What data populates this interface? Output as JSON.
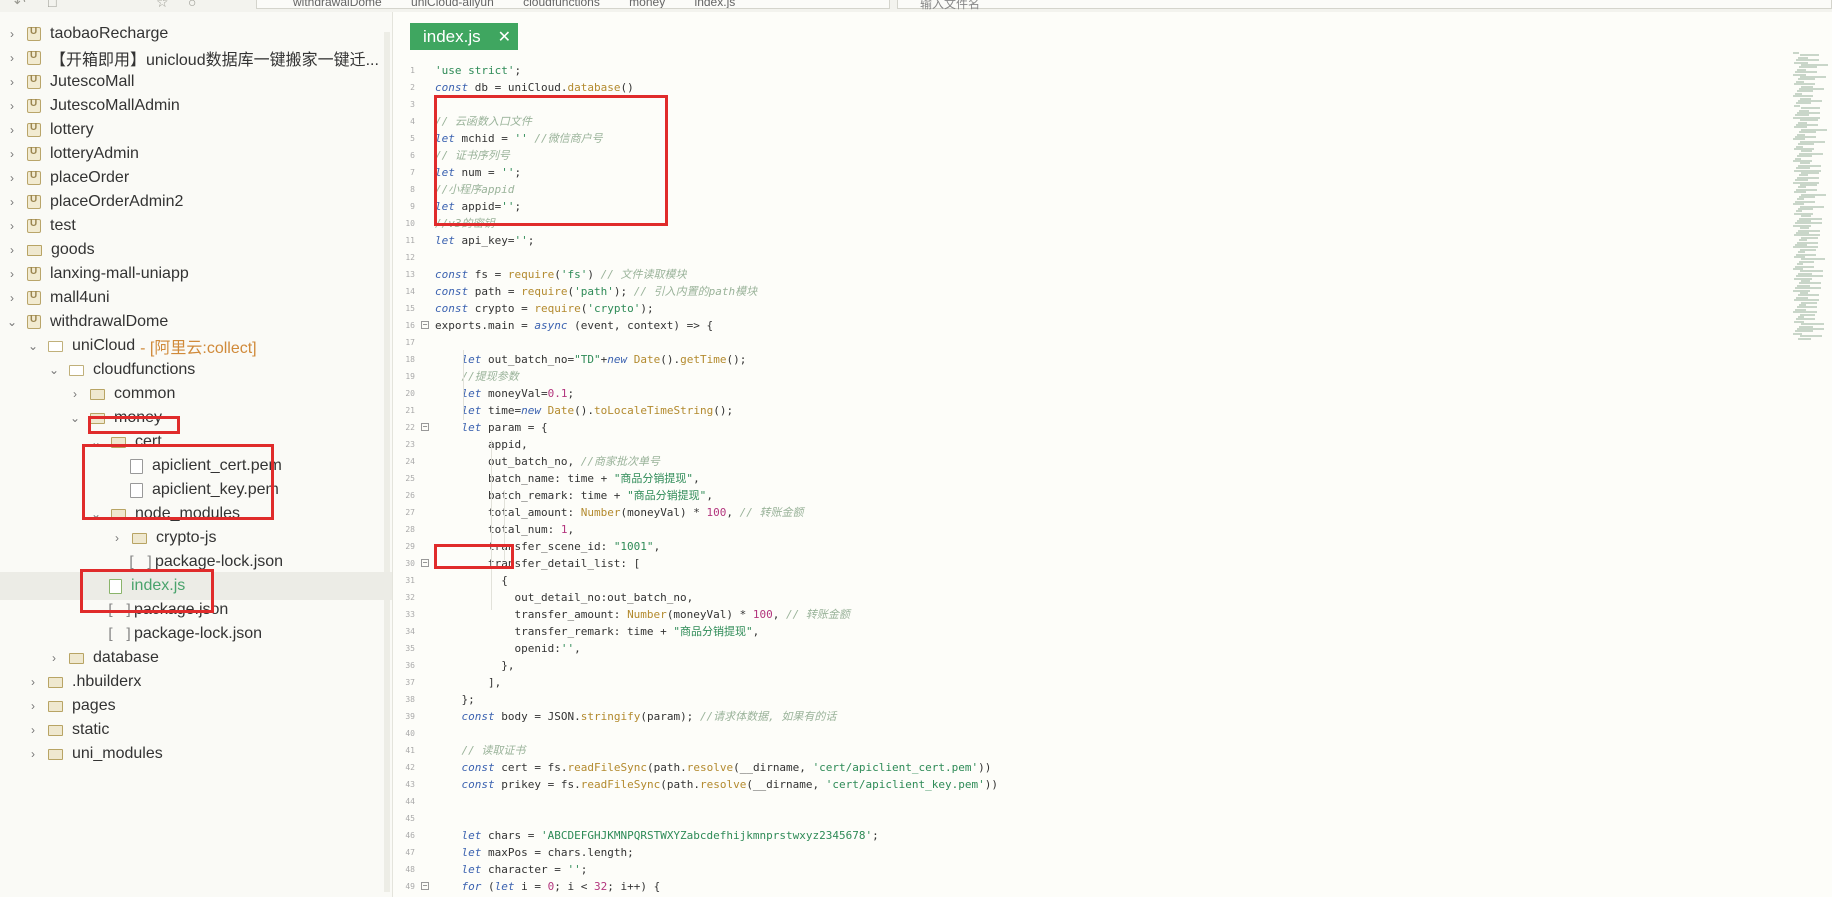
{
  "toolbar": {
    "breadcrumb": [
      "withdrawalDome",
      "uniCloud-aliyun",
      "cloudfunctions",
      "money",
      "index.js"
    ],
    "search_placeholder": "输入文件名"
  },
  "sidebar": {
    "items": [
      {
        "label": "taobaoRecharge"
      },
      {
        "label": "【开箱即用】unicloud数据库一键搬家一键迁..."
      },
      {
        "label": "JutescoMall"
      },
      {
        "label": "JutescoMallAdmin"
      },
      {
        "label": "lottery"
      },
      {
        "label": "lotteryAdmin"
      },
      {
        "label": "placeOrder"
      },
      {
        "label": "placeOrderAdmin2"
      },
      {
        "label": "test"
      },
      {
        "label": "goods"
      },
      {
        "label": "lanxing-mall-uniapp"
      },
      {
        "label": "mall4uni"
      },
      {
        "label": "withdrawalDome"
      },
      {
        "label": "uniCloud",
        "tag": "- [阿里云:collect]"
      },
      {
        "label": "cloudfunctions"
      },
      {
        "label": "common"
      },
      {
        "label": "money"
      },
      {
        "label": "cert"
      },
      {
        "label": "apiclient_cert.pem"
      },
      {
        "label": "apiclient_key.pem"
      },
      {
        "label": "node_modules"
      },
      {
        "label": "crypto-js"
      },
      {
        "label": "package-lock.json"
      },
      {
        "label": "index.js"
      },
      {
        "label": "package.json"
      },
      {
        "label": "package-lock.json"
      },
      {
        "label": "database"
      },
      {
        "label": ".hbuilderx"
      },
      {
        "label": "pages"
      },
      {
        "label": "static"
      },
      {
        "label": "uni_modules"
      }
    ]
  },
  "editor": {
    "tab_label": "index.js",
    "line_numbers": [
      "1",
      "2",
      "3",
      "4",
      "5",
      "6",
      "7",
      "8",
      "9",
      "10",
      "11",
      "12",
      "13",
      "14",
      "15",
      "16",
      "17",
      "18",
      "19",
      "20",
      "21",
      "22",
      "23",
      "24",
      "25",
      "26",
      "27",
      "28",
      "29",
      "30",
      "31",
      "32",
      "33",
      "34",
      "35",
      "36",
      "37",
      "38",
      "39",
      "40",
      "41",
      "42",
      "43",
      "44",
      "45",
      "46",
      "47",
      "48",
      "49"
    ]
  },
  "colors": {
    "tab_green": "#3fa660",
    "highlight_red": "#e02b2b",
    "selected_file_green": "#4aa36c",
    "uniCloud_tag": "#d08a3a"
  }
}
